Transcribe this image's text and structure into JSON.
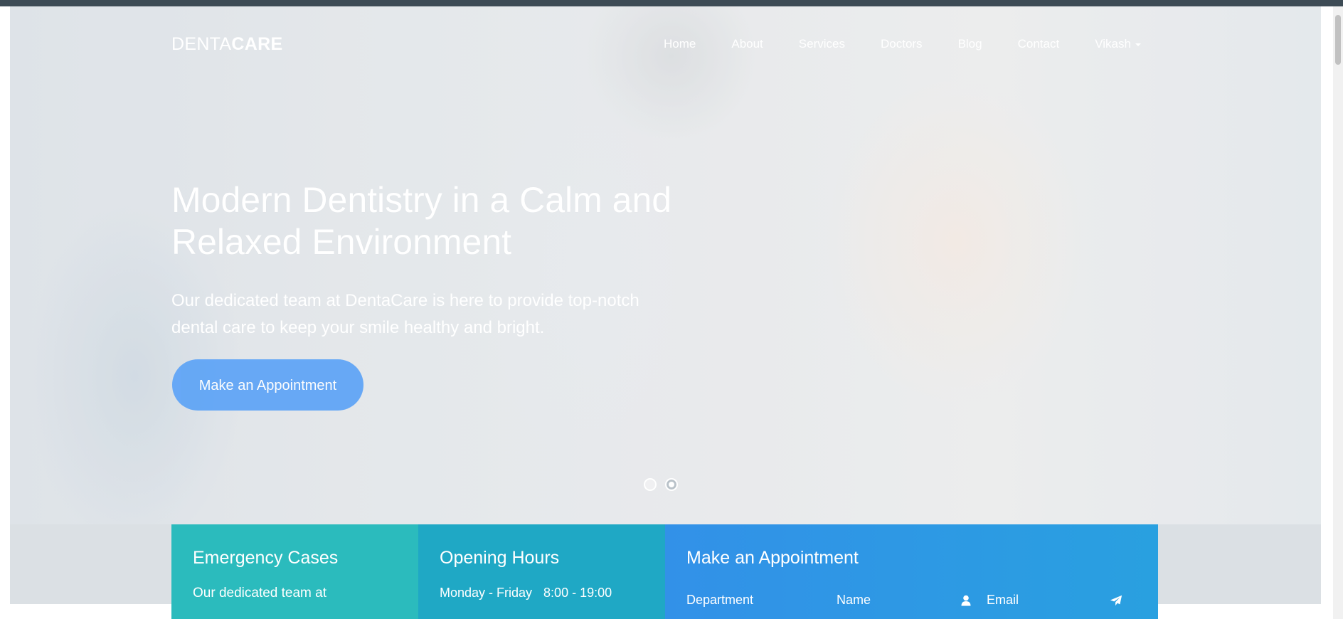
{
  "brand": {
    "light": "DENTA",
    "bold": "CARE"
  },
  "nav": {
    "items": [
      "Home",
      "About",
      "Services",
      "Doctors",
      "Blog",
      "Contact"
    ],
    "user": "Vikash"
  },
  "hero": {
    "headline": "Modern Dentistry in a Calm and Relaxed Environment",
    "subline": "Our dedicated team at DentaCare is here to provide top-notch dental care to keep your smile healthy and bright.",
    "cta": "Make an Appointment",
    "slides": 2,
    "active_slide": 2
  },
  "panels": {
    "emergency": {
      "title": "Emergency Cases",
      "text": "Our dedicated team at"
    },
    "hours": {
      "title": "Opening Hours",
      "days": "Monday - Friday",
      "time": "8:00 - 19:00"
    },
    "appointment": {
      "title": "Make an Appointment",
      "fields": [
        {
          "label": "Department",
          "icon": ""
        },
        {
          "label": "Name",
          "icon": "user-icon"
        },
        {
          "label": "Email",
          "icon": "paper-plane-icon"
        }
      ]
    }
  },
  "colors": {
    "emergency": "#2bbbbd",
    "hours": "#1fa8c5",
    "appointment": "#3291e8",
    "cta": "#5ea4f6"
  }
}
